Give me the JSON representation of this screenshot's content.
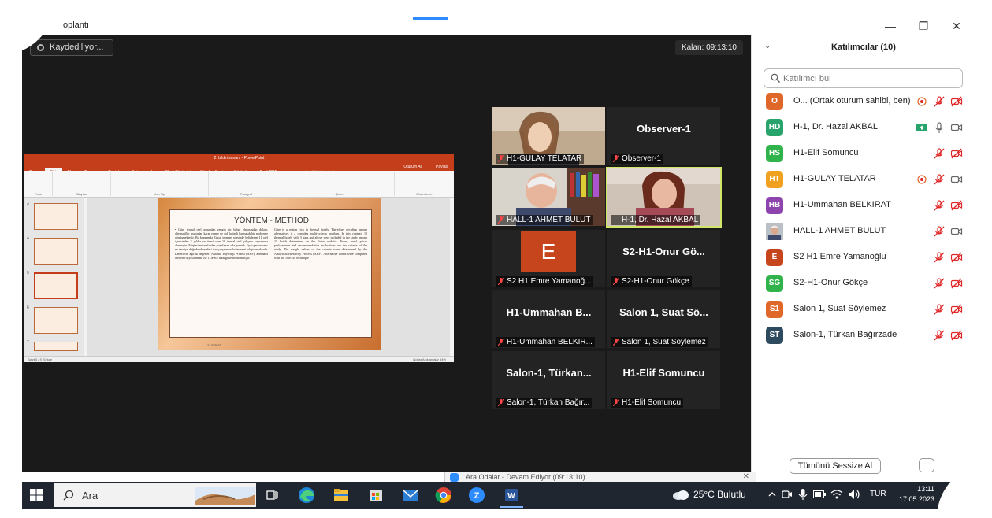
{
  "window": {
    "title": "oplantı",
    "minimize": "—",
    "restore": "❐",
    "close": "✕"
  },
  "meeting": {
    "recording_label": "Kaydediliyor...",
    "timer_label": "Kalan: 09:13:10"
  },
  "shared_screen": {
    "ppt_title": "2. bildiri sunum - PowerPoint",
    "ppt_tabs": [
      "Dosya",
      "Giriş",
      "Ekle",
      "Tasarım",
      "Geçişler",
      "Animasyonlar",
      "Slayt Gösterisi",
      "Gözden Geçir",
      "Görünüm",
      "Foxit PDF"
    ],
    "ppt_search": "Ne yapmak istediğinizi söyleyin",
    "ppt_user": "Oturum Aç",
    "ppt_share": "Paylaş",
    "ribbon_groups": [
      "Pano",
      "Slaytlar",
      "Yazı Tipi",
      "Paragraf",
      "Çizim",
      "Düzenleme"
    ],
    "thumb_numbers": [
      "3",
      "4",
      "5",
      "6",
      "7"
    ],
    "slide_heading": "YÖNTEM - METHOD",
    "slide_left_text": "• Güre termal otel açısından zengin bir bölge olmasından dolayı, alternatifler arasından karar verme de çok kriterli karmaşık bir probleme dönüşmektedir. Bu kapsamda Etstur internet sitesinde belirlenen 11 otel içerisinden 3 yıldız ve üzeri olan 10 termal otel çalışma kapsamına alınmıştır. Müşteriler tarafından puanlanan oda, yemek, fiyat-performans ve tavsiye değerlendirmeleri ise çalışmanın kriterlerini oluşturmaktadır. Kriterlerin ağırlık değerleri Analitik Hiyerarşi Prosesi (AHP), alternatif otellerin kıyaslanması ise TOPSIS tekniği ile belirlenmiştir.",
    "slide_right_text": "Güre is a region rich in thermal hotels. Therefore, deciding among alternatives is a complex multi-criteria problem. In this context, 10 thermal hotels with 3 stars and above were included in the study among 11 hotels determined on the Etstur website. Room, meal, price-performance and recommendation evaluations are the criteria of the study. The weight values of the criteria were determined by the Analytical Hierarchy Process (AHP). Alternative hotels were compared with the TOPSIS technique",
    "slide_date": "17.5.2023",
    "status_left": "Slayt 5 / 9    Türkçe",
    "status_right": "Notlar   Açıklamalar   54%"
  },
  "tiles": [
    {
      "name": "H1-GULAY TELATAR",
      "big": "",
      "type": "photo1"
    },
    {
      "name": "Observer-1",
      "big": "Observer-1",
      "type": "text"
    },
    {
      "name": "HALL-1 AHMET BULUT",
      "big": "",
      "type": "photo2"
    },
    {
      "name": "H-1, Dr. Hazal AKBAL",
      "big": "",
      "type": "photo3"
    },
    {
      "name": "S2 H1 Emre Yamanoğ...",
      "big": "E",
      "type": "avatar"
    },
    {
      "name": "S2-H1-Onur Gökçe",
      "big": "S2-H1-Onur Gö...",
      "type": "text"
    },
    {
      "name": "H1-Ummahan BELKIR...",
      "big": "H1-Ummahan B...",
      "type": "text"
    },
    {
      "name": "Salon 1, Suat Söylemez",
      "big": "Salon 1, Suat Sö...",
      "type": "text"
    },
    {
      "name": "Salon-1, Türkan Bağır...",
      "big": "Salon-1, Türkan...",
      "type": "text"
    },
    {
      "name": "H1-Elif Somuncu",
      "big": "H1-Elif Somuncu",
      "type": "text"
    }
  ],
  "panel": {
    "chevron": "⌄",
    "title": "Katılımcılar (10)",
    "search_placeholder": "Katılımcı bul",
    "participants": [
      {
        "initials": "O",
        "name": "O... (Ortak oturum sahibi, ben)",
        "color": "#e0672a",
        "icons": [
          "record",
          "mic-off",
          "cam-off"
        ]
      },
      {
        "initials": "HD",
        "name": "H-1, Dr. Hazal AKBAL",
        "color": "#27a46b",
        "icons": [
          "screen-share",
          "mic-on",
          "cam-on"
        ]
      },
      {
        "initials": "HS",
        "name": "H1-Elif Somuncu",
        "color": "#2fb34a",
        "icons": [
          "mic-off",
          "cam-off"
        ]
      },
      {
        "initials": "HT",
        "name": "H1-GULAY TELATAR",
        "color": "#f0a11f",
        "icons": [
          "record",
          "mic-off",
          "cam-on"
        ]
      },
      {
        "initials": "HB",
        "name": "H1-Ummahan BELKIRAT",
        "color": "#8e44ad",
        "icons": [
          "mic-off",
          "cam-off"
        ]
      },
      {
        "initials": "",
        "name": "HALL-1 AHMET BULUT",
        "color": "#9aa3ab",
        "icons": [
          "mic-off",
          "cam-on"
        ]
      },
      {
        "initials": "E",
        "name": "S2 H1 Emre Yamanoğlu",
        "color": "#c6451d",
        "icons": [
          "mic-off",
          "cam-off"
        ]
      },
      {
        "initials": "SG",
        "name": "S2-H1-Onur Gökçe",
        "color": "#2fb34a",
        "icons": [
          "mic-off",
          "cam-off"
        ]
      },
      {
        "initials": "S1",
        "name": "Salon 1, Suat Söylemez",
        "color": "#e0672a",
        "icons": [
          "mic-off",
          "cam-off"
        ]
      },
      {
        "initials": "ST",
        "name": "Salon-1, Türkan Bağırzade",
        "color": "#2e4a5e",
        "icons": [
          "mic-off",
          "cam-off"
        ]
      }
    ],
    "mute_all": "Tümünü Sessize Al",
    "more": "···"
  },
  "notification": {
    "text": "Ara Odalar - Devam Ediyor (09:13:10)",
    "close": "✕"
  },
  "taskbar": {
    "search_text": "Ara",
    "weather": "25°C  Bulutlu",
    "lang": "TUR",
    "time": "13:11",
    "date": "17.05.2023"
  },
  "colors": {
    "meeting_bg": "#1a1a1a",
    "accent_zoom": "#2d8cff",
    "mute_red": "#e02828",
    "ppt_red": "#c43e1c",
    "active_speaker": "#cfe66b"
  }
}
